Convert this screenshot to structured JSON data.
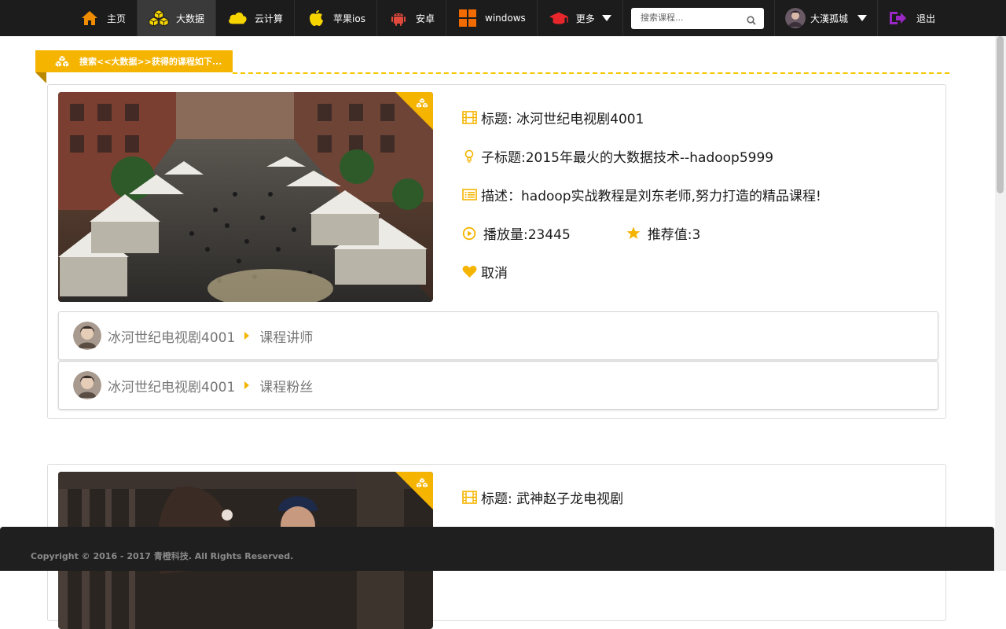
{
  "nav": {
    "items": [
      {
        "label": "主页",
        "icon": "home-icon"
      },
      {
        "label": "大数据",
        "icon": "cubes-icon"
      },
      {
        "label": "云计算",
        "icon": "cloud-icon"
      },
      {
        "label": "苹果ios",
        "icon": "apple-icon"
      },
      {
        "label": "安卓",
        "icon": "android-icon"
      },
      {
        "label": "windows",
        "icon": "windows-icon"
      },
      {
        "label": "更多",
        "icon": "graduation-cap-icon"
      }
    ],
    "active_index": 1,
    "search_placeholder": "搜索课程...",
    "user_name": "大漢孤城",
    "logout_label": "退出"
  },
  "section": {
    "heading": "搜索<<大数据>>获得的课程如下..."
  },
  "courses": [
    {
      "title": "标题: 冰河世纪电视剧4001",
      "subtitle": "子标题:2015年最火的大数据技术--hadoop5999",
      "description": "描述：hadoop实战教程是刘东老师,努力打造的精品课程!",
      "plays": "播放量:23445",
      "rating": "推荐值:3",
      "favorite": "取消",
      "related": [
        {
          "name": "冰河世纪电视剧4001",
          "label": "课程讲师"
        },
        {
          "name": "冰河世纪电视剧4001",
          "label": "课程粉丝"
        }
      ]
    },
    {
      "title": "标题: 武神赵子龙电视剧"
    }
  ],
  "footer": {
    "copyright": "Copyright © 2016 - 2017 青橙科技. All Rights Reserved."
  },
  "colors": {
    "accent": "#f5b400",
    "nav_bg": "#1c1c1c",
    "footer_bg": "#1f1f1f"
  }
}
